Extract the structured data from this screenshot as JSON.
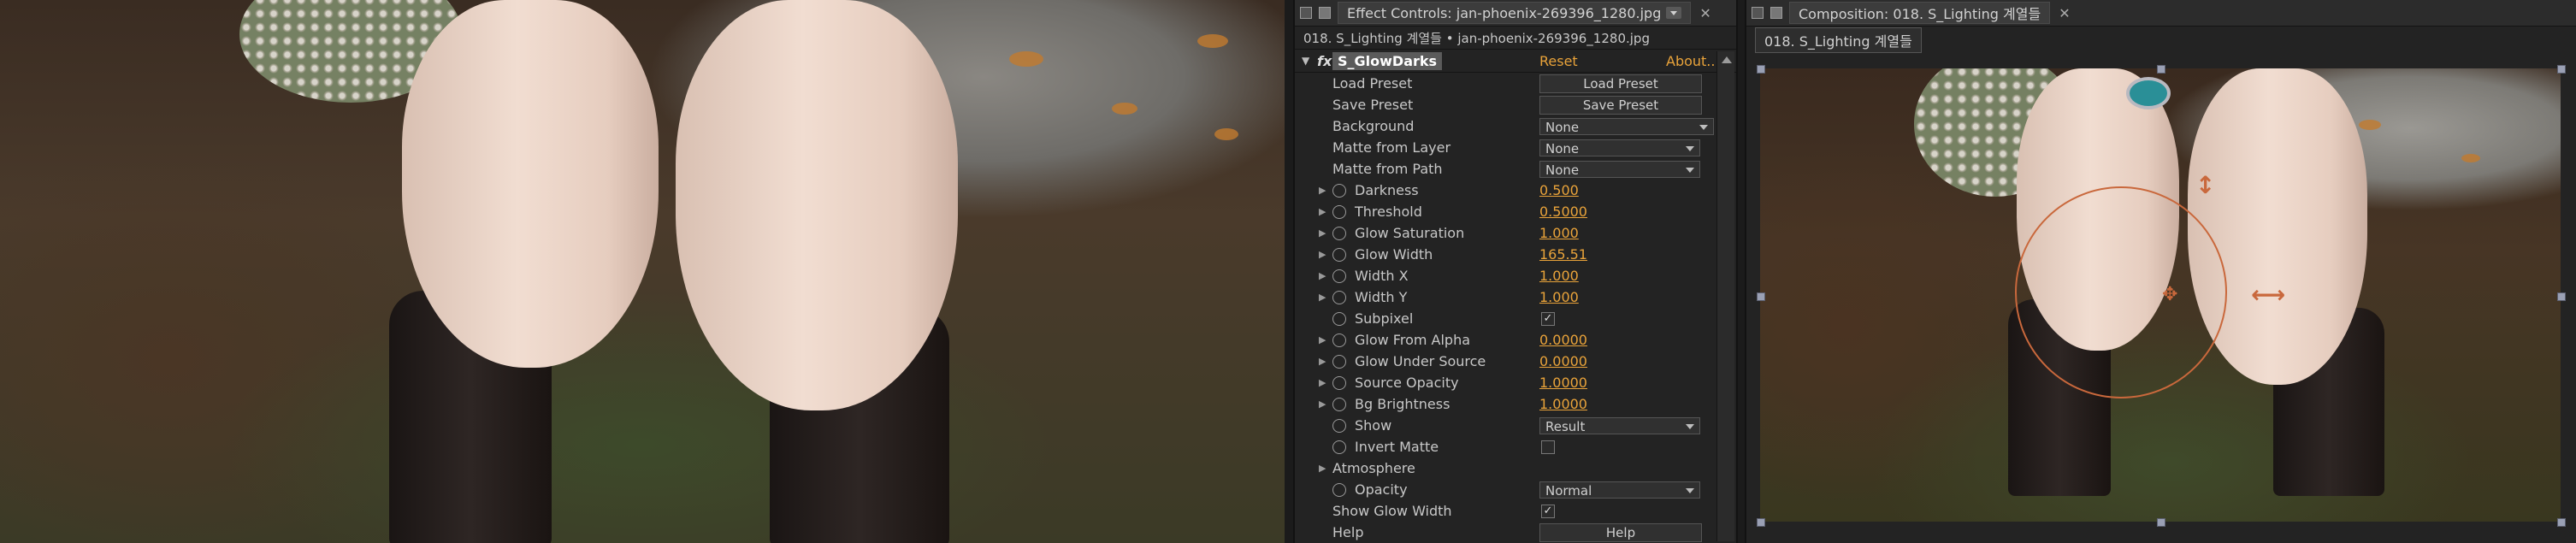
{
  "effect_controls": {
    "tab_title": "Effect Controls: jan-phoenix-269396_1280.jpg",
    "breadcrumb": "018. S_Lighting 계열들 • jan-phoenix-269396_1280.jpg",
    "effect_name": "S_GlowDarks",
    "fx_glyph": "fx",
    "reset_label": "Reset",
    "about_label": "About...",
    "rows": [
      {
        "label": "Load Preset",
        "kind": "button",
        "button": "Load Preset"
      },
      {
        "label": "Save Preset",
        "kind": "button",
        "button": "Save Preset"
      },
      {
        "label": "Background",
        "kind": "select",
        "select": "None"
      },
      {
        "label": "Matte from Layer",
        "kind": "select",
        "select": "None"
      },
      {
        "label": "Matte from Path",
        "kind": "select",
        "select": "None"
      },
      {
        "label": "Darkness",
        "kind": "value",
        "value": "0.500"
      },
      {
        "label": "Threshold",
        "kind": "value",
        "value": "0.5000"
      },
      {
        "label": "Glow Saturation",
        "kind": "value",
        "value": "1.000"
      },
      {
        "label": "Glow Width",
        "kind": "value",
        "value": "165.51"
      },
      {
        "label": "Width X",
        "kind": "value",
        "value": "1.000"
      },
      {
        "label": "Width Y",
        "kind": "value",
        "value": "1.000"
      },
      {
        "label": "Subpixel",
        "kind": "check",
        "checked": "✓"
      },
      {
        "label": "Glow From Alpha",
        "kind": "value",
        "value": "0.0000"
      },
      {
        "label": "Glow Under Source",
        "kind": "value",
        "value": "0.0000"
      },
      {
        "label": "Source Opacity",
        "kind": "value",
        "value": "1.0000"
      },
      {
        "label": "Bg Brightness",
        "kind": "value",
        "value": "1.0000"
      },
      {
        "label": "Show",
        "kind": "select",
        "select": "Result"
      },
      {
        "label": "Invert Matte",
        "kind": "check",
        "checked": ""
      },
      {
        "label": "Atmosphere",
        "kind": "group"
      },
      {
        "label": "Opacity",
        "kind": "select",
        "select": "Normal"
      },
      {
        "label": "Show Glow Width",
        "kind": "check",
        "checked": "✓"
      },
      {
        "label": "Help",
        "kind": "button",
        "button": "Help"
      }
    ]
  },
  "composition": {
    "tab_title": "Composition: 018. S_Lighting 계열들",
    "sub_chip": "018. S_Lighting 계열들"
  },
  "icons": {
    "close": "✕",
    "crosshair": "✥",
    "arrows_h": "⟷",
    "arrows_v": "↕"
  }
}
